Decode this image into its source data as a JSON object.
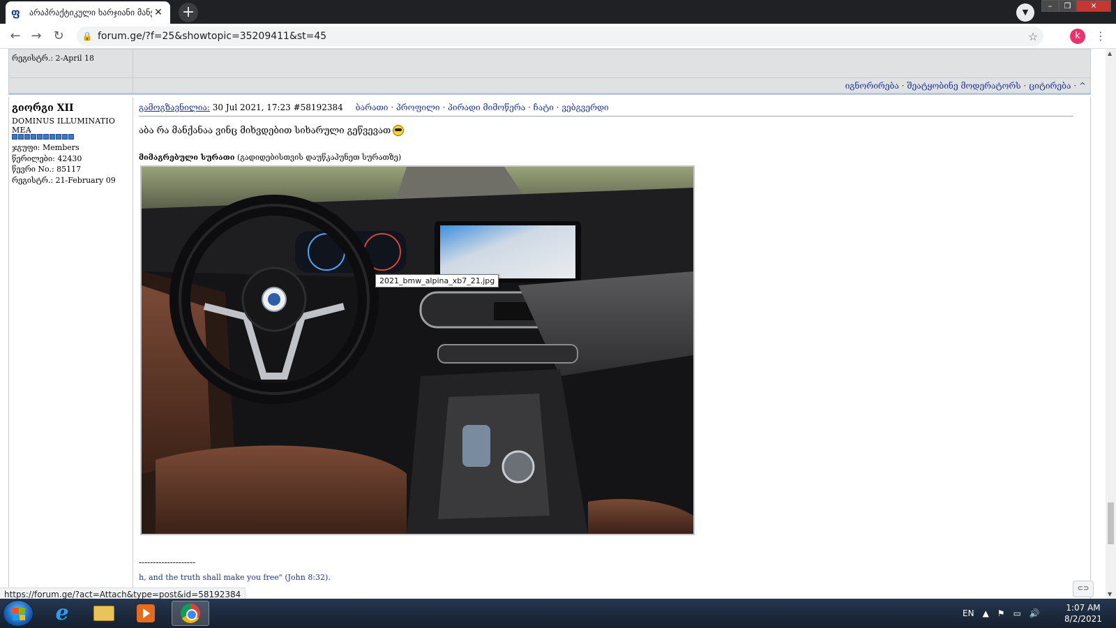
{
  "browser": {
    "tab_title": "არაპრაქტიკული ხარჯიანი მანქ",
    "tab_favicon": "ფ",
    "url": "forum.ge/?f=25&showtopic=35209411&st=45",
    "profile_initial": "k"
  },
  "prev_post": {
    "register_label": "რეგისტრ.: 2-April 18"
  },
  "action_bar": {
    "links": "იგნორირება · შეატყობინე მოდერატორს  · ციტირება · ^"
  },
  "post": {
    "author": "გიორგი XII",
    "author_title": "DOMINUS ILLUMINATIO MEA",
    "pip_count": 10,
    "group": "ჯგუფი: Members",
    "posts": "წერილები: 42430",
    "member_no": "წევრი No.: 85117",
    "registered": "რეგისტრ.: 21-February 09",
    "sent_label": "გამოგზავნილია:",
    "date": " 30 Jul 2021, 17:23  #58192384",
    "header_links": "ბარათი · პროფილი · პირადი მიმოწერა · ჩატი · ვებგვერდი",
    "message": "აბა რა მანქანაა ვინც მიხვდებით სიხარული გეწვევათ",
    "attach_label": "მიმაგრებული სურათი",
    "attach_note": " (გადიდებისთვის დაუწკაპუნეთ სურათზე)",
    "image_tooltip": "2021_bmw_alpina_xb7_21.jpg",
    "signature_line": "--------------------",
    "signature_text": "h, and the truth shall make you free\" (John 8:32)."
  },
  "status_bar": {
    "url": "https://forum.ge/?act=Attach&type=post&id=58192384"
  },
  "taskbar": {
    "language": "EN",
    "time": "1:07 AM",
    "date": "8/2/2021"
  },
  "colors": {
    "link": "#1a3399",
    "post_bg": "#dfe1e3",
    "pip": "#3e78c4"
  }
}
